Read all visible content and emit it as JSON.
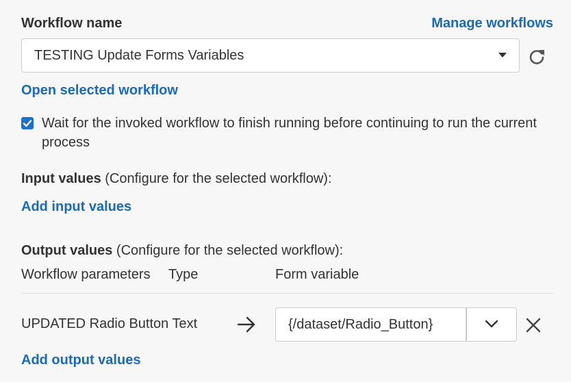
{
  "workflow": {
    "label": "Workflow name",
    "manage_link": "Manage workflows",
    "selected": "TESTING Update Forms Variables",
    "open_link": "Open selected workflow",
    "refresh_icon": "refresh-icon"
  },
  "wait_option": {
    "checked": true,
    "text": "Wait for the invoked workflow to finish running before continuing to run the current process"
  },
  "input_values": {
    "title": "Input values",
    "note": "(Configure for the selected workflow):",
    "add_link": "Add input values"
  },
  "output_values": {
    "title": "Output values",
    "note": "(Configure for the selected workflow):",
    "columns": [
      "Workflow parameters",
      "Type",
      "Form variable"
    ],
    "rows": [
      {
        "parameter": "UPDATED Radio Button Text",
        "type": "",
        "form_variable": "{/dataset/Radio_Button}"
      }
    ],
    "add_link": "Add output values"
  },
  "colors": {
    "link": "#1a6bbd",
    "checkbox": "#1a73c9",
    "text": "#333333",
    "background": "#f7f7f7"
  }
}
